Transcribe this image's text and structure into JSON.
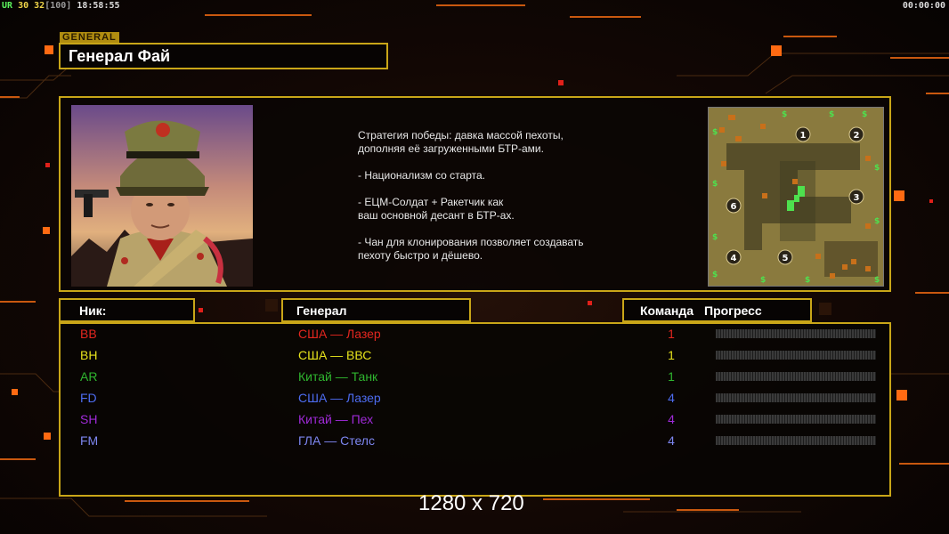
{
  "hud": {
    "left": {
      "tag": "UR",
      "v1": "30",
      "v2": "32",
      "bracket": "[100]",
      "clock": "18:58:55"
    },
    "right_time": "00:00:00"
  },
  "general_tag": "GENERAL",
  "general_name": "Генерал Фай",
  "description": "Стратегия победы: давка массой пехоты,\n дополняя её загруженными БТР-ами.\n\n- Национализм со старта.\n\n- ЕЦМ-Солдат + Ракетчик как\nваш основной десант в БТР-ах.\n\n- Чан для клонирования позволяет создавать\n пехоту быстро и дёшево.",
  "minimap": {
    "spawns": [
      "1",
      "2",
      "3",
      "4",
      "5",
      "6"
    ]
  },
  "headers": {
    "nick": "Ник:",
    "general": "Генерал",
    "team": "Команда",
    "progress": "Прогресс"
  },
  "players": [
    {
      "nick": "BB",
      "general": "США — Лазер",
      "team": "1",
      "color": "#e2261f",
      "progress": 0
    },
    {
      "nick": "BH",
      "general": "США — ВВС",
      "team": "1",
      "color": "#e6e21c",
      "progress": 0
    },
    {
      "nick": "AR",
      "general": "Китай — Танк",
      "team": "1",
      "color": "#2fb52f",
      "progress": 0
    },
    {
      "nick": "FD",
      "general": "США — Лазер",
      "team": "4",
      "color": "#4d6cf0",
      "progress": 0
    },
    {
      "nick": "SH",
      "general": "Китай — Пех",
      "team": "4",
      "color": "#a02ad8",
      "progress": 0
    },
    {
      "nick": "FM",
      "general": "ГЛА — Стелс",
      "team": "4",
      "color": "#7d86f0",
      "progress": 0
    }
  ],
  "resolution_text": "1280 x 720"
}
